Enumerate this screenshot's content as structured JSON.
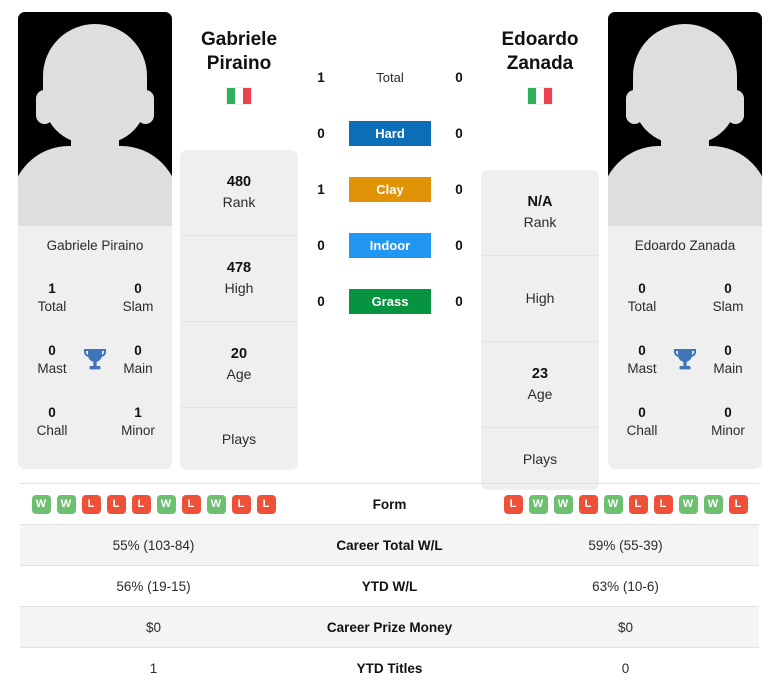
{
  "players": {
    "left": {
      "first_name": "Gabriele",
      "last_name": "Piraino",
      "photo_name": "Gabriele Piraino",
      "flag": "italy-flag",
      "titles": {
        "total_value": "1",
        "total_label": "Total",
        "slam_value": "0",
        "slam_label": "Slam",
        "mast_value": "0",
        "mast_label": "Mast",
        "main_value": "0",
        "main_label": "Main",
        "chall_value": "0",
        "chall_label": "Chall",
        "minor_value": "1",
        "minor_label": "Minor"
      },
      "stats": {
        "rank_value": "480",
        "rank_label": "Rank",
        "high_value": "478",
        "high_label": "High",
        "age_value": "20",
        "age_label": "Age",
        "plays_value": "",
        "plays_label": "Plays"
      },
      "form": [
        "W",
        "W",
        "L",
        "L",
        "L",
        "W",
        "L",
        "W",
        "L",
        "L"
      ],
      "career_total_wl": "55% (103-84)",
      "ytd_wl": "56% (19-15)",
      "career_prize_money": "$0",
      "ytd_titles": "1"
    },
    "right": {
      "first_name": "Edoardo",
      "last_name": "Zanada",
      "photo_name": "Edoardo Zanada",
      "flag": "italy-flag",
      "titles": {
        "total_value": "0",
        "total_label": "Total",
        "slam_value": "0",
        "slam_label": "Slam",
        "mast_value": "0",
        "mast_label": "Mast",
        "main_value": "0",
        "main_label": "Main",
        "chall_value": "0",
        "chall_label": "Chall",
        "minor_value": "0",
        "minor_label": "Minor"
      },
      "stats": {
        "rank_value": "N/A",
        "rank_label": "Rank",
        "high_value": "",
        "high_label": "High",
        "age_value": "23",
        "age_label": "Age",
        "plays_value": "",
        "plays_label": "Plays"
      },
      "form": [
        "L",
        "W",
        "W",
        "L",
        "W",
        "L",
        "L",
        "W",
        "W",
        "L"
      ],
      "career_total_wl": "59% (55-39)",
      "ytd_wl": "63% (10-6)",
      "career_prize_money": "$0",
      "ytd_titles": "0"
    }
  },
  "head_to_head": {
    "rows": [
      {
        "label": "Total",
        "left": "1",
        "right": "0",
        "color": ""
      },
      {
        "label": "Hard",
        "left": "0",
        "right": "0",
        "color": "#0d6eb8"
      },
      {
        "label": "Clay",
        "left": "1",
        "right": "0",
        "color": "#e09306"
      },
      {
        "label": "Indoor",
        "left": "0",
        "right": "0",
        "color": "#2196f3"
      },
      {
        "label": "Grass",
        "left": "0",
        "right": "0",
        "color": "#079440"
      }
    ]
  },
  "table": {
    "rows": [
      {
        "label": "Form"
      },
      {
        "label": "Career Total W/L"
      },
      {
        "label": "YTD W/L"
      },
      {
        "label": "Career Prize Money"
      },
      {
        "label": "YTD Titles"
      }
    ]
  },
  "colors": {
    "card_bg": "#efefef",
    "win": "#6cc070",
    "loss": "#ef5138",
    "trophy": "#3f74b8"
  }
}
